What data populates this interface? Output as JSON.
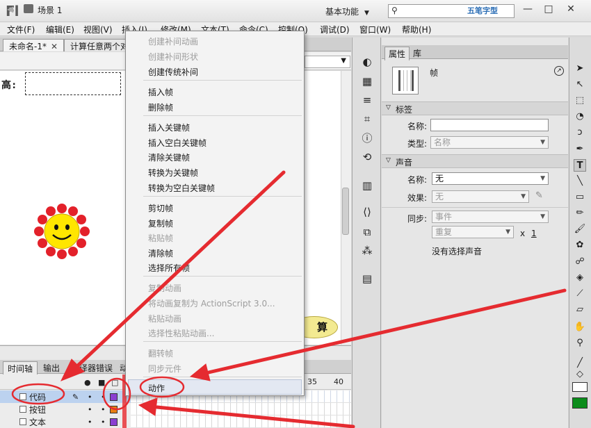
{
  "app": {
    "logo": "Fl",
    "workspace": "基本功能",
    "watermark": "五笔字型"
  },
  "window_controls": {
    "minimize": "—",
    "restore": "□",
    "close": "✕"
  },
  "menubar": [
    "文件(F)",
    "编辑(E)",
    "视图(V)",
    "插入(I)",
    "修改(M)",
    "文本(T)",
    "命令(C)",
    "控制(O)",
    "调试(D)",
    "窗口(W)",
    "帮助(H)"
  ],
  "doc_tabs": [
    {
      "label": "未命名-1*",
      "close": "✕"
    },
    {
      "label": "计算任意两个对",
      "close": ""
    }
  ],
  "scene": {
    "label": "场景 1"
  },
  "stage": {
    "label_text": "高:",
    "button_text": "算"
  },
  "context_menu": [
    {
      "label": "创建补间动画",
      "disabled": true
    },
    {
      "label": "创建补间形状",
      "disabled": true
    },
    {
      "label": "创建传统补间",
      "disabled": false
    },
    {
      "label": "插入帧",
      "disabled": false
    },
    {
      "label": "删除帧",
      "disabled": false
    },
    {
      "label": "插入关键帧",
      "disabled": false
    },
    {
      "label": "插入空白关键帧",
      "disabled": false
    },
    {
      "label": "清除关键帧",
      "disabled": false
    },
    {
      "label": "转换为关键帧",
      "disabled": false
    },
    {
      "label": "转换为空白关键帧",
      "disabled": false
    },
    {
      "label": "剪切帧",
      "disabled": false
    },
    {
      "label": "复制帧",
      "disabled": false
    },
    {
      "label": "粘贴帧",
      "disabled": true
    },
    {
      "label": "清除帧",
      "disabled": false
    },
    {
      "label": "选择所有帧",
      "disabled": false
    },
    {
      "label": "复制动画",
      "disabled": true
    },
    {
      "label": "将动画复制为 ActionScript 3.0...",
      "disabled": true
    },
    {
      "label": "粘贴动画",
      "disabled": true
    },
    {
      "label": "选择性粘贴动画...",
      "disabled": true
    },
    {
      "label": "翻转帧",
      "disabled": true
    },
    {
      "label": "同步元件",
      "disabled": true
    },
    {
      "label": "动作",
      "disabled": false
    }
  ],
  "timeline": {
    "tabs": [
      "时间轴",
      "输出",
      "编译器错误",
      "动"
    ],
    "frame_numbers": [
      "35",
      "40"
    ],
    "layers": [
      {
        "name": "代码",
        "color": "#8a3fd1",
        "selected": true
      },
      {
        "name": "按钮",
        "color": "#e87e10",
        "selected": false
      },
      {
        "name": "文本",
        "color": "#8a3fd1",
        "selected": false
      }
    ]
  },
  "properties": {
    "tabs": [
      "属性",
      "库"
    ],
    "title": "帧",
    "sections": {
      "label": "标签",
      "sound": "声音"
    },
    "label_name": "名称:",
    "label_name_value": "",
    "label_type": "类型:",
    "label_type_value": "名称",
    "sound_name": "名称:",
    "sound_name_value": "无",
    "sound_effect": "效果:",
    "sound_effect_value": "无",
    "sound_sync": "同步:",
    "sound_sync_value": "事件",
    "sound_repeat_value": "重复",
    "repeat_x": "x",
    "repeat_count": "1",
    "no_sound": "没有选择声音"
  }
}
